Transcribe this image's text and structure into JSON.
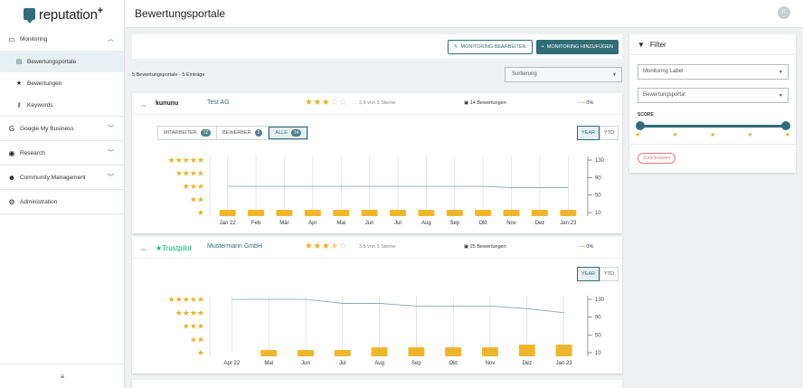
{
  "app": {
    "logo_text": "reputation",
    "logo_plus": "+",
    "page_title": "Bewertungsportale",
    "avatar_initials": "IT"
  },
  "sidebar": {
    "groups": [
      {
        "label": "Monitoring",
        "icon": "monitoring-icon",
        "expanded": true,
        "items": [
          {
            "label": "Bewertungsportale",
            "icon": "portal-icon",
            "active": true
          },
          {
            "label": "Bewertungen",
            "icon": "star-icon"
          },
          {
            "label": "Keywords",
            "icon": "key-icon"
          }
        ]
      },
      {
        "label": "Google My Business",
        "icon": "google-icon"
      },
      {
        "label": "Research",
        "icon": "compass-icon"
      },
      {
        "label": "Community Management",
        "icon": "community-icon"
      },
      {
        "label": "Administration",
        "icon": "gear-icon"
      }
    ],
    "collapse_label": "≡"
  },
  "toolbar": {
    "edit_label": "MONITORING BEARBEITEN",
    "add_label": "MONITORING HINZUFÜGEN"
  },
  "summary": {
    "text": "5 Bewertungsportale - 5 Einträge",
    "sort_placeholder": "Sortierung"
  },
  "cards": [
    {
      "brand": "kununu",
      "company": "Test AG",
      "rating_stars": 3,
      "rating_text": "2,8 von 5 Sterne",
      "reviews": "14 Bewertungen",
      "trend": "0%",
      "tabs": [
        {
          "label": "MITARBEITER",
          "count": "12"
        },
        {
          "label": "BEWERBER",
          "count": "2"
        },
        {
          "label": "ALLE",
          "count": "14",
          "active": true
        }
      ],
      "range": [
        "YEAR",
        "YTD"
      ],
      "chart_data": {
        "type": "bar",
        "categories": [
          "Jan 22",
          "Feb",
          "Mär",
          "Apr",
          "Mai",
          "Jun",
          "Jul",
          "Aug",
          "Sep",
          "Okt",
          "Nov",
          "Dez",
          "Jan 23"
        ],
        "values": [
          1,
          1,
          1,
          1,
          1,
          1,
          1,
          1,
          1,
          1,
          1,
          1,
          1
        ],
        "line_values": [
          3,
          3,
          3,
          3,
          3,
          3,
          3,
          3,
          3,
          3,
          2.9,
          2.9,
          2.9
        ],
        "y_right_ticks": [
          "130",
          "90",
          "50",
          "10"
        ],
        "y_left_star_levels": [
          5,
          4,
          3,
          2,
          1
        ],
        "ylim": [
          0,
          130
        ]
      }
    },
    {
      "brand": "Trustpilot",
      "company": "Mustermann GmbH",
      "rating_stars": 3.5,
      "rating_text": "3,5 von 5 Sterne",
      "reviews": "25 Bewertungen",
      "trend": "0%",
      "range": [
        "YEAR",
        "YTD"
      ],
      "chart_data": {
        "type": "bar",
        "categories": [
          "Apr 22",
          "Mai",
          "Jun",
          "Jul",
          "Aug",
          "Sep",
          "Okt",
          "Nov",
          "Dez",
          "Jan 23"
        ],
        "values": [
          0,
          1,
          1,
          1,
          2,
          2,
          2,
          2,
          3,
          3
        ],
        "line_values": [
          5,
          5,
          5,
          4.7,
          4.7,
          4.5,
          4.5,
          4.5,
          4.3,
          4.0
        ],
        "y_right_ticks": [
          "130",
          "90",
          "50",
          "10"
        ],
        "y_left_star_levels": [
          5,
          4,
          3,
          2,
          1
        ],
        "ylim": [
          0,
          130
        ]
      }
    }
  ],
  "filter": {
    "title": "Filter",
    "monitoring_label": "Monitoring Label",
    "portal_label": "Bewertungsportal",
    "score_label": "SCORE",
    "score_range": [
      1,
      5
    ],
    "reset_label": "Zurücksetzen"
  }
}
